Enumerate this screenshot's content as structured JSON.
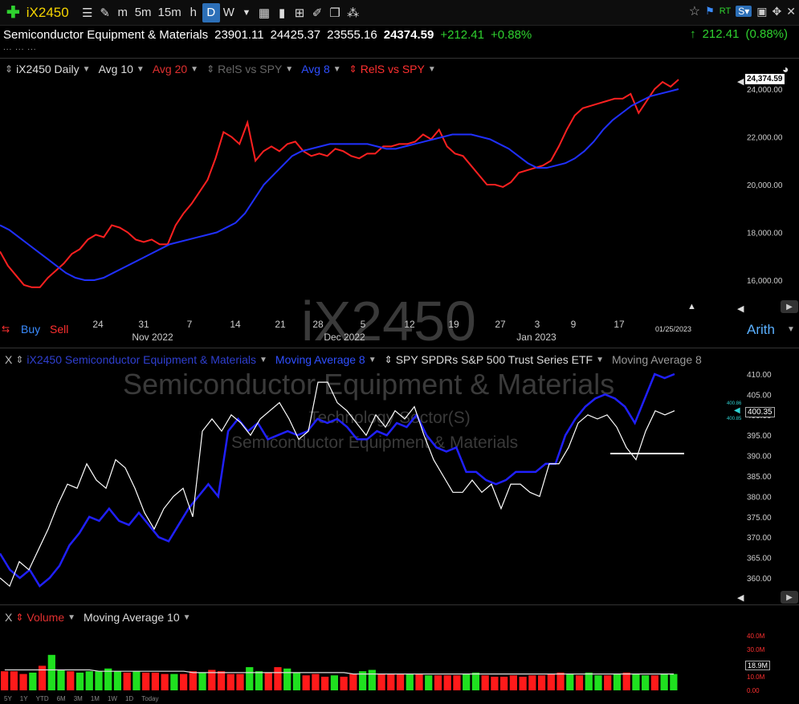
{
  "toolbar": {
    "symbol": "iX2450",
    "periods": [
      "m",
      "5m",
      "15m",
      "h",
      "D",
      "W"
    ],
    "active_period": "D",
    "rt_label": "RT"
  },
  "quote": {
    "name": "Semiconductor Equipment & Materials",
    "open": "23901.11",
    "high": "24425.37",
    "low": "23555.16",
    "last": "24374.59",
    "change": "+212.41",
    "pct": "+0.88%",
    "right_change": "212.41",
    "right_pct": "(0.88%)",
    "dots": "... ... ..."
  },
  "main_legend": {
    "symbol": "iX2450 Daily",
    "items": [
      {
        "label": "Avg 10",
        "color": "#dddddd"
      },
      {
        "label": "Avg 20",
        "color": "#e03030"
      },
      {
        "label": "RelS vs SPY",
        "color": "#777777"
      },
      {
        "label": "Avg 8",
        "color": "#2f4fff"
      },
      {
        "label": "RelS vs SPY",
        "color": "#ff3030"
      }
    ],
    "buy": "Buy",
    "sell": "Sell",
    "last_price_tag": "24,374.59",
    "date_tag": "01/25/2023",
    "scale_mode": "Arith",
    "watermark": "iX2450"
  },
  "rs_legend": {
    "close": "X",
    "items": [
      {
        "label": "iX2450 Semiconductor Equipment & Materials",
        "color": "#2f3fd0"
      },
      {
        "label": "Moving Average 8",
        "color": "#2f4fff"
      },
      {
        "label": "SPY SPDRs S&P 500 Trust Series ETF",
        "color": "#dddddd"
      },
      {
        "label": "Moving Average 8",
        "color": "#999999"
      }
    ],
    "watermark_1": "Semiconductor Equipment & Materials",
    "watermark_2": "Technology Sector(S)",
    "watermark_3": "Semiconductor Equipment & Materials",
    "last_tag": "400.35",
    "small_tag_1": "400.86",
    "small_tag_2": "400.85"
  },
  "volume_legend": {
    "close": "X",
    "items": [
      {
        "label": "Volume",
        "color": "#e03030"
      },
      {
        "label": "Moving Average 10",
        "color": "#dddddd"
      }
    ],
    "last_tag": "18.9M",
    "axis_labels": [
      "40.0M",
      "30.0M",
      "20.0M",
      "10.0M",
      "0.00"
    ]
  },
  "range_buttons": [
    "5Y",
    "1Y",
    "YTD",
    "6M",
    "3M",
    "1M",
    "1W",
    "1D",
    "Today"
  ],
  "chart_data": [
    {
      "type": "line",
      "title": "iX2450 Daily",
      "x_tick_labels": [
        "24",
        "31",
        "7",
        "14",
        "21",
        "28",
        "5",
        "12",
        "19",
        "27",
        "3",
        "9",
        "17"
      ],
      "month_labels": [
        "Nov 2022",
        "Dec 2022",
        "Jan 2023"
      ],
      "ylim": [
        15000,
        24800
      ],
      "y_ticks": [
        16000,
        18000,
        20000,
        22000,
        24000
      ],
      "y_tick_labels": [
        "16,000.00",
        "18,000.00",
        "20,000.00",
        "22,000.00",
        "24,000.00"
      ],
      "series": [
        {
          "name": "Avg 20",
          "color": "#ff2020",
          "values": [
            17200,
            16600,
            16200,
            15800,
            15700,
            15700,
            16100,
            16400,
            16700,
            17100,
            17300,
            17700,
            17900,
            17800,
            18300,
            18200,
            18000,
            17700,
            17600,
            17700,
            17500,
            17500,
            18300,
            18800,
            19200,
            19700,
            20200,
            21100,
            22200,
            22000,
            21700,
            22600,
            21000,
            21400,
            21600,
            21400,
            21700,
            21800,
            21400,
            21200,
            21300,
            21200,
            21500,
            21400,
            21200,
            21100,
            21300,
            21300,
            21600,
            21600,
            21700,
            21700,
            21800,
            22100,
            21900,
            22300,
            21600,
            21300,
            21200,
            20800,
            20400,
            20000,
            20000,
            19900,
            20100,
            20500,
            20600,
            20700,
            20800,
            21000,
            21600,
            22300,
            22900,
            23200,
            23300,
            23400,
            23500,
            23600,
            23600,
            23800,
            23000,
            23500,
            24000,
            24300,
            24100,
            24400
          ]
        },
        {
          "name": "Avg 8",
          "color": "#2030ff",
          "values": [
            18300,
            18100,
            17800,
            17500,
            17200,
            16900,
            16600,
            16300,
            16100,
            16000,
            16000,
            16100,
            16300,
            16500,
            16700,
            16900,
            17100,
            17300,
            17500,
            17600,
            17700,
            17800,
            17900,
            18000,
            18200,
            18400,
            18800,
            19400,
            20000,
            20400,
            20800,
            21200,
            21400,
            21500,
            21600,
            21700,
            21700,
            21700,
            21700,
            21700,
            21600,
            21500,
            21500,
            21600,
            21700,
            21800,
            21900,
            22000,
            22100,
            22100,
            22100,
            22000,
            21900,
            21700,
            21500,
            21200,
            20900,
            20700,
            20700,
            20800,
            20900,
            21100,
            21400,
            21800,
            22300,
            22700,
            23000,
            23300,
            23500,
            23700,
            23800,
            23900,
            24000
          ]
        }
      ]
    },
    {
      "type": "line",
      "ylim": [
        355,
        412
      ],
      "y_ticks": [
        360,
        365,
        370,
        375,
        380,
        385,
        390,
        395,
        400,
        405,
        410
      ],
      "series": [
        {
          "name": "iX2450 Semiconductor Equipment & Materials",
          "color": "#2020ff",
          "values": [
            366,
            362,
            360,
            362,
            358,
            360,
            363,
            368,
            371,
            375,
            374,
            377,
            374,
            373,
            376,
            373,
            370,
            369,
            373,
            377,
            380,
            383,
            380,
            396,
            399,
            396,
            398,
            394,
            395,
            396,
            395,
            396,
            399,
            398,
            399,
            397,
            394,
            394,
            396,
            395,
            398,
            397,
            400,
            395,
            392,
            391,
            392,
            386,
            386,
            384,
            383,
            384,
            386,
            386,
            386,
            388,
            388,
            395,
            399,
            402,
            404,
            405,
            404,
            402,
            398,
            404,
            410,
            409,
            410
          ]
        },
        {
          "name": "SPY SPDRs S&P 500 Trust Series ETF",
          "color": "#ffffff",
          "values": [
            360,
            358,
            364,
            362,
            367,
            372,
            378,
            383,
            382,
            388,
            384,
            382,
            389,
            387,
            382,
            376,
            372,
            377,
            380,
            382,
            375,
            396,
            399,
            396,
            400,
            398,
            395,
            399,
            401,
            403,
            399,
            394,
            396,
            408,
            408,
            403,
            401,
            398,
            395,
            400,
            397,
            401,
            399,
            402,
            395,
            389,
            385,
            381,
            381,
            384,
            381,
            383,
            377,
            383,
            383,
            381,
            380,
            388,
            388,
            392,
            398,
            400,
            399,
            400,
            397,
            392,
            389,
            396,
            401,
            400,
            401
          ]
        }
      ],
      "reference_level": 390.5
    },
    {
      "type": "bar",
      "ylim": [
        0,
        44
      ],
      "y_ticks": [
        0,
        10,
        20,
        30,
        40
      ],
      "bar_values": [
        14,
        14,
        12,
        13,
        18,
        26,
        15,
        14,
        13,
        14,
        14,
        16,
        14,
        13,
        14,
        13,
        13,
        12,
        12,
        12,
        14,
        13,
        15,
        14,
        12,
        12,
        17,
        14,
        13,
        17,
        16,
        13,
        11,
        12,
        10,
        11,
        10,
        12,
        14,
        15,
        12,
        12,
        12,
        12,
        12,
        11,
        11,
        11,
        11,
        12,
        13,
        11,
        10,
        10,
        11,
        10,
        11,
        11,
        12,
        13,
        12,
        11,
        13,
        11,
        11,
        12,
        13,
        12,
        11,
        11,
        12,
        12
      ],
      "bar_colors": [
        "r",
        "r",
        "r",
        "g",
        "r",
        "g",
        "g",
        "r",
        "g",
        "g",
        "g",
        "g",
        "g",
        "r",
        "g",
        "r",
        "r",
        "r",
        "g",
        "r",
        "r",
        "g",
        "r",
        "r",
        "r",
        "r",
        "g",
        "g",
        "r",
        "r",
        "g",
        "g",
        "r",
        "r",
        "r",
        "g",
        "r",
        "r",
        "g",
        "g",
        "r",
        "r",
        "r",
        "g",
        "r",
        "g",
        "r",
        "r",
        "r",
        "g",
        "g",
        "r",
        "r",
        "r",
        "r",
        "r",
        "r",
        "r",
        "r",
        "r",
        "g",
        "r",
        "g",
        "g",
        "r",
        "g",
        "r",
        "g",
        "g",
        "r",
        "g",
        "g"
      ],
      "moving_average": [
        15,
        15,
        15,
        15,
        15,
        15,
        15,
        15,
        15,
        15,
        14,
        14,
        14,
        14,
        14,
        14,
        14,
        14,
        14,
        14,
        13,
        13,
        13,
        13,
        13,
        13,
        13,
        13,
        13,
        13,
        13,
        13,
        13,
        13,
        13,
        13,
        13,
        12,
        12,
        12,
        12,
        12,
        12,
        12,
        12,
        12,
        12,
        12,
        12,
        12,
        12,
        12,
        12,
        12,
        12,
        12,
        12,
        12,
        12,
        12,
        12,
        12,
        12,
        12,
        12,
        12,
        12,
        12,
        12,
        12,
        12,
        12
      ]
    }
  ]
}
